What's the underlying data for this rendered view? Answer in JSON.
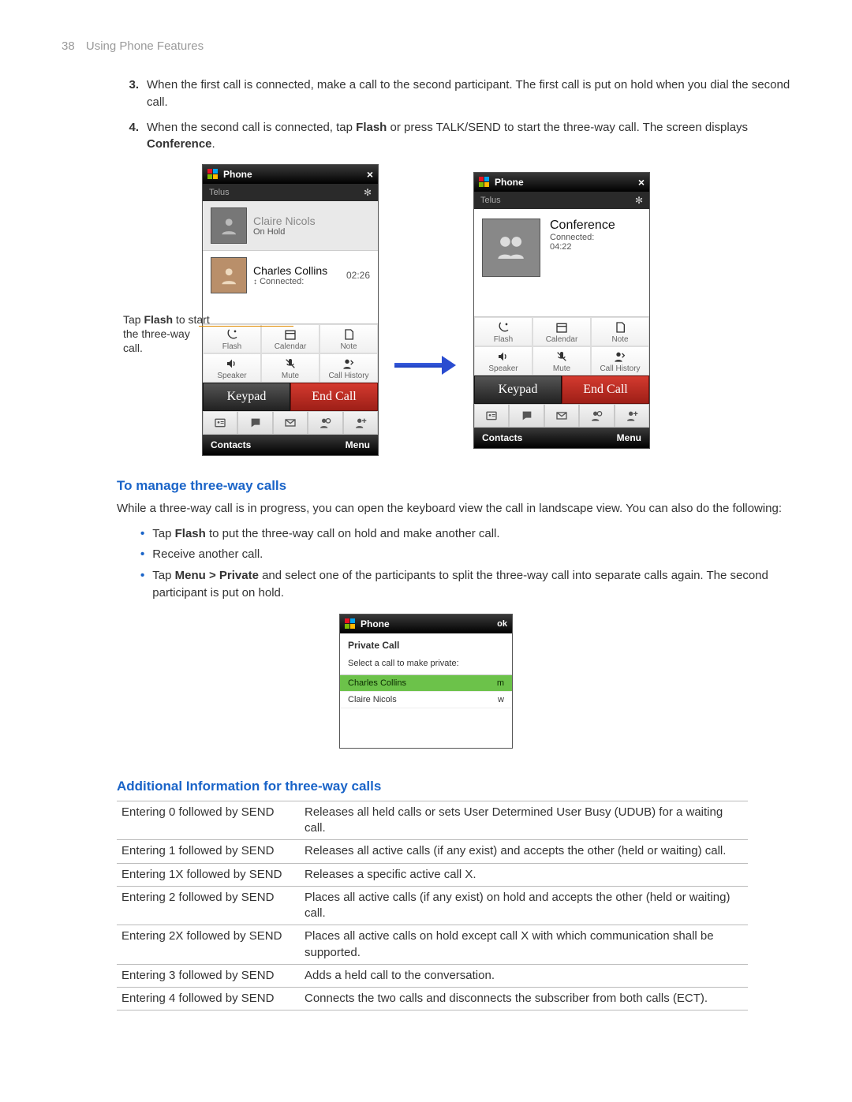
{
  "header": {
    "page_number": "38",
    "section": "Using Phone Features"
  },
  "steps": {
    "s3": {
      "num": "3.",
      "text_a": "When the first call is connected, make a call to the second participant. The first call is put on hold when you dial the second call."
    },
    "s4": {
      "num": "4.",
      "text_a": "When the second call is connected, tap ",
      "bold1": "Flash",
      "text_b": " or press TALK/SEND to start the three-way call. The screen displays ",
      "bold2": "Conference",
      "text_c": "."
    }
  },
  "callout": {
    "line1": "Tap ",
    "bold": "Flash",
    "line2": " to start the three-way call."
  },
  "phone_left": {
    "title": "Phone",
    "carrier": "Telus",
    "hold": {
      "name": "Claire Nicols",
      "status": "On Hold"
    },
    "active": {
      "name": "Charles Collins",
      "status": "Connected:",
      "time": "02:26"
    },
    "grid": {
      "flash": "Flash",
      "calendar": "Calendar",
      "note": "Note",
      "speaker": "Speaker",
      "mute": "Mute",
      "history": "Call History"
    },
    "keypad": "Keypad",
    "endcall": "End Call",
    "soft_left": "Contacts",
    "soft_right": "Menu"
  },
  "phone_right": {
    "title": "Phone",
    "carrier": "Telus",
    "conf": {
      "name": "Conference",
      "status": "Connected:",
      "time": "04:22"
    },
    "grid": {
      "flash": "Flash",
      "calendar": "Calendar",
      "note": "Note",
      "speaker": "Speaker",
      "mute": "Mute",
      "history": "Call History"
    },
    "keypad": "Keypad",
    "endcall": "End Call",
    "soft_left": "Contacts",
    "soft_right": "Menu"
  },
  "sect_manage": {
    "heading": "To manage three-way calls",
    "para": "While a three-way call is in progress, you can open the keyboard view the call in landscape view. You can also do the following:",
    "b1_a": "Tap ",
    "b1_bold": "Flash",
    "b1_b": " to put the three-way call on hold and make another call.",
    "b2": "Receive another call.",
    "b3_a": "Tap ",
    "b3_bold": "Menu > Private",
    "b3_b": " and select one of the participants to split the three-way call into separate calls again. The second participant is put on hold."
  },
  "phone_private": {
    "title": "Phone",
    "ok": "ok",
    "heading": "Private Call",
    "prompt": "Select a call to make private:",
    "row1": {
      "name": "Charles Collins",
      "tag": "m"
    },
    "row2": {
      "name": "Claire Nicols",
      "tag": "w"
    }
  },
  "sect_addl": {
    "heading": "Additional Information for three-way calls"
  },
  "table": {
    "r1": {
      "c1": "Entering 0 followed by SEND",
      "c2": "Releases all held calls or sets User Determined User Busy (UDUB) for a waiting call."
    },
    "r2": {
      "c1": "Entering 1 followed by SEND",
      "c2": "Releases all active calls (if any exist) and accepts the other (held or waiting) call."
    },
    "r3": {
      "c1": "Entering 1X followed by SEND",
      "c2": "Releases a specific active call X."
    },
    "r4": {
      "c1": "Entering 2 followed by SEND",
      "c2": "Places all active calls (if any exist) on hold and accepts the other (held or waiting) call."
    },
    "r5": {
      "c1": "Entering 2X followed by SEND",
      "c2": "Places all active calls on hold except call X with which communication shall be supported."
    },
    "r6": {
      "c1": "Entering 3 followed by SEND",
      "c2": "Adds a held call to the conversation."
    },
    "r7": {
      "c1": "Entering 4 followed by SEND",
      "c2": "Connects the two calls and disconnects the subscriber from both calls (ECT)."
    }
  }
}
